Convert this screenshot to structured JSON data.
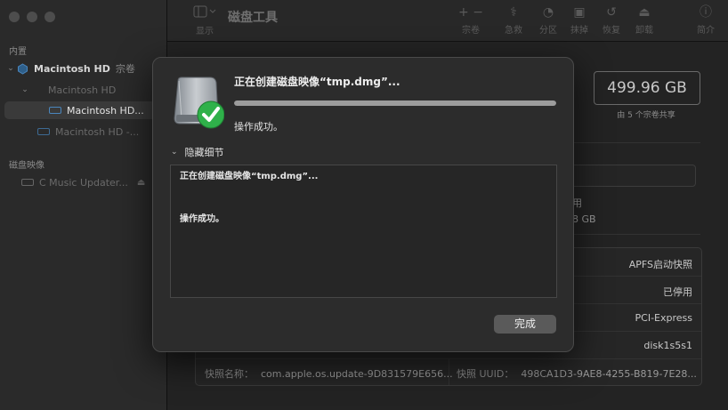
{
  "sidebar": {
    "section_internal": "内置",
    "section_images": "磁盘映像",
    "items": [
      {
        "name": "Macintosh HD",
        "tag": "宗卷"
      },
      {
        "name": "Macintosh HD"
      },
      {
        "name": "Macintosh HD..."
      },
      {
        "name": "Macintosh HD -..."
      },
      {
        "name": "C Music Updater..."
      }
    ]
  },
  "toolbar": {
    "title": "磁盘工具",
    "view_label": "显示",
    "add_remove": "+ −",
    "buttons": [
      "宗卷",
      "急救",
      "分区",
      "抹掉",
      "恢复",
      "卸载",
      "简介"
    ]
  },
  "background": {
    "capacity": "499.96 GB",
    "capacity_sub": "由 5 个宗卷共享",
    "frag_used": "用",
    "frag_gb": "8 GB",
    "info_values": [
      "APFS启动快照",
      "已停用",
      "PCI-Express",
      "disk1s5s1"
    ],
    "snapshot_name_key": "快照名称：",
    "snapshot_name_val": "com.apple.os.update-9D831579E656...",
    "snapshot_uuid_key": "快照 UUID：",
    "snapshot_uuid_val": "498CA1D3-9AE8-4255-B819-7E28..."
  },
  "dialog": {
    "title": "正在创建磁盘映像“tmp.dmg”...",
    "progress": 1.0,
    "status": "操作成功。",
    "hide_details": "隐藏细节",
    "log_line1": "正在创建磁盘映像“tmp.dmg”...",
    "log_line2": "操作成功。",
    "done": "完成"
  },
  "colors": {
    "success": "#2fb14a",
    "progress": "#9c9c9c",
    "selection": "#3a3a3a"
  }
}
